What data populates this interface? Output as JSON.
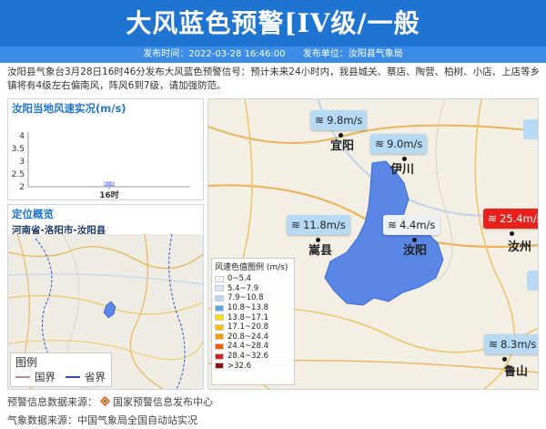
{
  "header": {
    "title": "大风蓝色预警[IV级/一般",
    "publish_time": "发布时间：2022-03-28 16:46:00",
    "publisher": "发布单位：汝阳县气象局"
  },
  "description": "汝阳县气象台3月28日16时46分发布大风蓝色预警信号：预计未来24小时内，我县城关、蔡店、陶营、柏树、小店、上店等乡镇将有4级左右偏南风，阵风6到7级，请加强防范。",
  "chart_panel": {
    "title": "汝阳当地风速实况(m/s)"
  },
  "chart_data": {
    "type": "bar",
    "categories": [
      "16时"
    ],
    "values": [
      2.2
    ],
    "title": "汝阳当地风速实况(m/s)",
    "xlabel": "",
    "ylabel": "",
    "ylim": [
      2,
      4
    ],
    "yticks": [
      "2",
      "2.5",
      "3",
      "3.5",
      "4"
    ],
    "data_labels": [
      "2.2"
    ],
    "bar_color": "#9aa7e8"
  },
  "location_panel": {
    "title": "定位概览",
    "subtitle": "河南省-洛阳市-汝阳县",
    "legend_title": "图例",
    "legend_items": [
      {
        "label": "国界",
        "color": "#c97e8c"
      },
      {
        "label": "省界",
        "color": "#2a4fd6"
      }
    ]
  },
  "map": {
    "stations": [
      {
        "name": "宜阳",
        "speed": "9.8m/s",
        "level": "lv1"
      },
      {
        "name": "伊川",
        "speed": "9.0m/s",
        "level": "lv1"
      },
      {
        "name": "嵩县",
        "speed": "11.8m/s",
        "level": "lv1"
      },
      {
        "name": "汝阳",
        "speed": "4.4m/s",
        "level": "lv0"
      },
      {
        "name": "汝州",
        "speed": "25.4m/s",
        "level": "lv4"
      },
      {
        "name": "鲁山",
        "speed": "8.3m/s",
        "level": "lv1"
      }
    ],
    "legend_title": "风速色值图例 (m/s)",
    "legend": [
      {
        "label": "0~5.4",
        "color": "#f4f4f4"
      },
      {
        "label": "5.4~7.9",
        "color": "#d6e9f8"
      },
      {
        "label": "7.9~10.8",
        "color": "#b6d9f4"
      },
      {
        "label": "10.8~13.8",
        "color": "#5ba7e8"
      },
      {
        "label": "13.8~17.1",
        "color": "#f5e100"
      },
      {
        "label": "17.1~20.8",
        "color": "#f5c000"
      },
      {
        "label": "20.8~24.4",
        "color": "#f59a00"
      },
      {
        "label": "24.4~28.4",
        "color": "#f25a00"
      },
      {
        "label": "28.4~32.6",
        "color": "#d41f1f"
      },
      {
        "label": ">32.6",
        "color": "#8b0d0d"
      }
    ],
    "county_fill": "#5a86e6"
  },
  "footer": {
    "line1_prefix": "预警信息数据来源：",
    "line1_source": "国家预警信息发布中心",
    "line2": "气象数据来源：中国气象局全国自动站实况"
  },
  "colors": {
    "banner": "#1f74d2",
    "meta_bar": "#3b8ce6",
    "accent": "#1f74d2"
  }
}
